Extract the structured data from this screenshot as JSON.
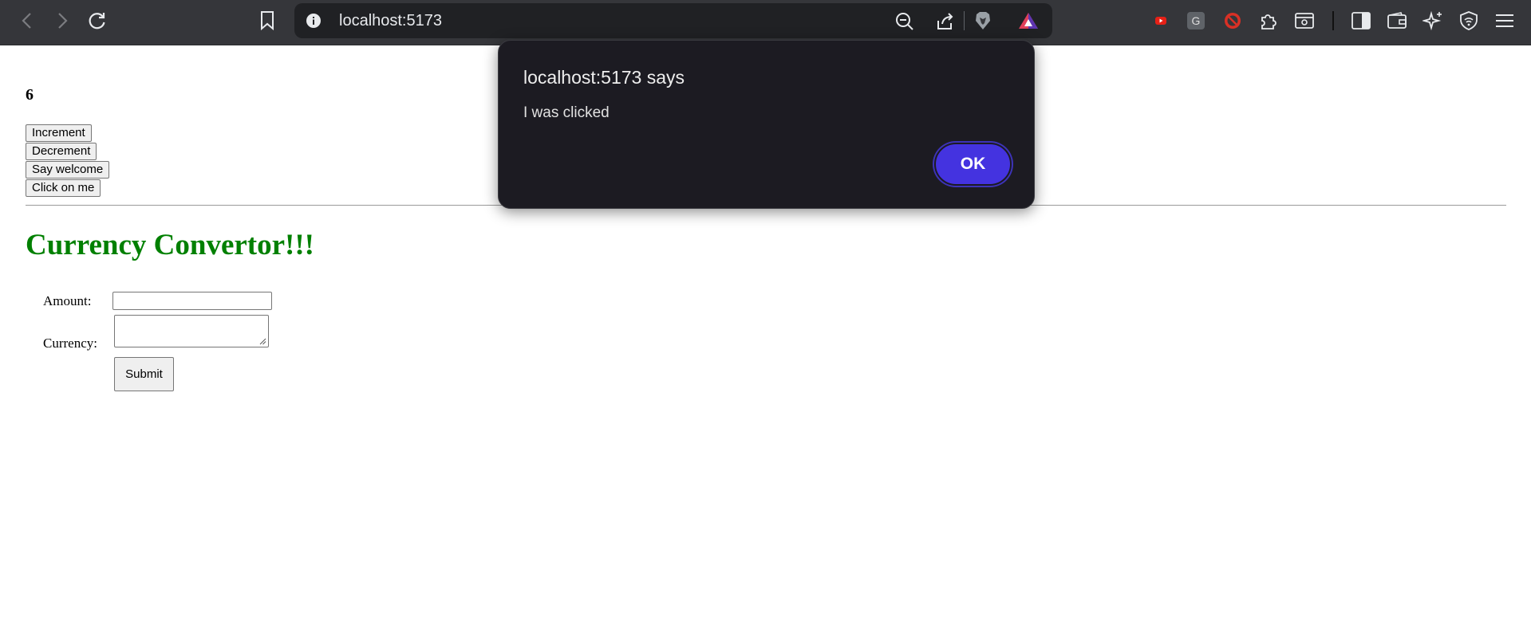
{
  "browser": {
    "url": "localhost:5173",
    "extensions": {
      "grammarly_letter": "G"
    }
  },
  "page": {
    "counter_value": "6",
    "buttons": {
      "increment": "Increment",
      "decrement": "Decrement",
      "say_welcome": "Say welcome",
      "click_on_me": "Click on me"
    },
    "heading": "Currency Convertor!!!",
    "form": {
      "amount_label": "Amount:",
      "amount_value": "",
      "currency_label": "Currency:",
      "currency_value": "",
      "submit_label": "Submit"
    }
  },
  "dialog": {
    "title": "localhost:5173 says",
    "message": "I was clicked",
    "ok_label": "OK"
  },
  "colors": {
    "heading": "#008000",
    "ok_button": "#4433e0",
    "dialog_bg": "#1c1b22",
    "toolbar_bg": "#35363a"
  }
}
